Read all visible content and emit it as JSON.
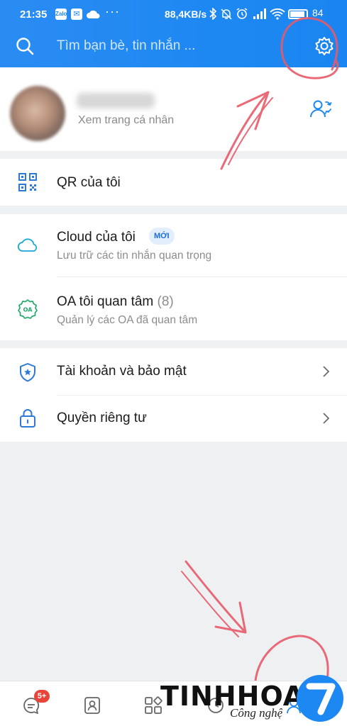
{
  "status_bar": {
    "time": "21:35",
    "app_icon_1": "Zalo",
    "speed": "88,4KB/s",
    "battery": "84"
  },
  "search": {
    "placeholder": "Tìm bạn bè, tin nhắn ..."
  },
  "profile": {
    "subtitle": "Xem trang cá nhân"
  },
  "menu": {
    "qr": {
      "title": "QR của tôi"
    },
    "cloud": {
      "title": "Cloud của tôi",
      "badge": "MỚI",
      "subtitle": "Lưu trữ các tin nhắn quan trọng"
    },
    "oa": {
      "title": "OA tôi quan tâm",
      "count": "(8)",
      "subtitle": "Quản lý các OA đã quan tâm"
    },
    "account": {
      "title": "Tài khoản và bảo mật"
    },
    "privacy": {
      "title": "Quyền riêng tư"
    }
  },
  "bottom_nav": {
    "message_badge": "5+"
  },
  "watermark": {
    "brand": "TINHHOA",
    "tagline": "Công nghệ",
    "logo_text": "7"
  },
  "icons": [
    "search-icon",
    "gear-icon",
    "switch-account-icon",
    "qr-code-icon",
    "cloud-icon",
    "oa-icon",
    "shield-icon",
    "lock-icon",
    "chevron-right-icon",
    "message-icon",
    "contacts-icon",
    "discover-icon"
  ],
  "colors": {
    "header": "#1e88f2",
    "accent": "#1c6fd0",
    "badge_red": "#e9443a",
    "annotation": "#e85a6a"
  }
}
